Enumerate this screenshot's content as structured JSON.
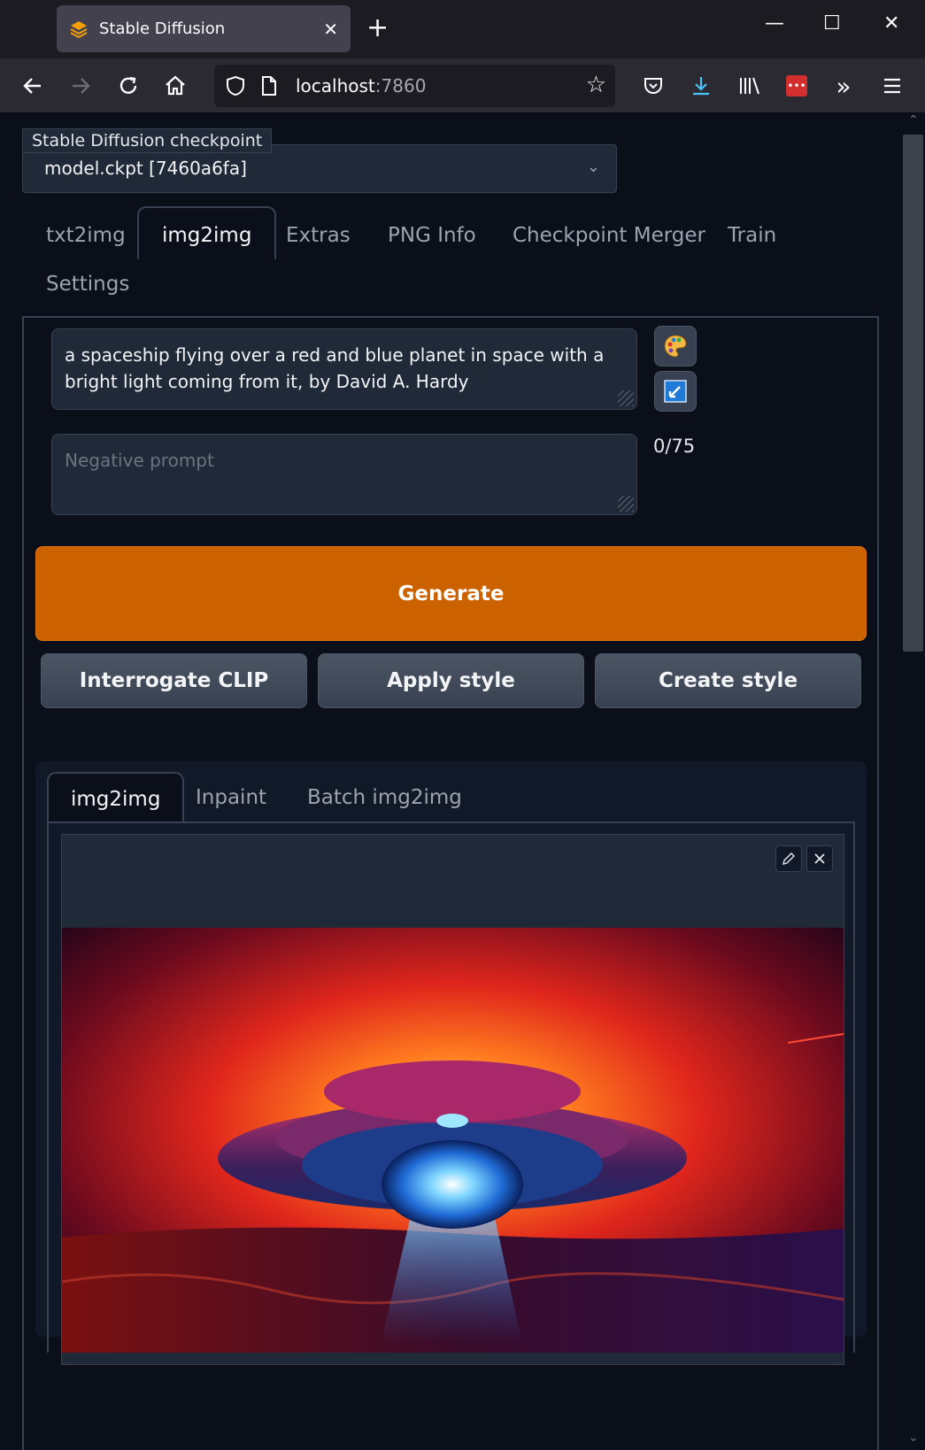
{
  "browser": {
    "tab_title": "Stable Diffusion",
    "url_host": "localhost",
    "url_port": ":7860"
  },
  "checkpoint": {
    "label": "Stable Diffusion checkpoint",
    "value": "model.ckpt [7460a6fa]"
  },
  "main_tabs": [
    "txt2img",
    "img2img",
    "Extras",
    "PNG Info",
    "Checkpoint Merger",
    "Train",
    "Settings"
  ],
  "prompt": {
    "text": "a spaceship flying over a red and blue planet in space with a bright light coming from it, by David A. Hardy",
    "negative_placeholder": "Negative prompt",
    "token_count": "0/75"
  },
  "buttons": {
    "generate": "Generate",
    "interrogate": "Interrogate CLIP",
    "apply_style": "Apply style",
    "create_style": "Create style"
  },
  "sub_tabs": [
    "img2img",
    "Inpaint",
    "Batch img2img"
  ],
  "colors": {
    "generate_bg": "#cc6100",
    "page_bg": "#0b0f19"
  }
}
